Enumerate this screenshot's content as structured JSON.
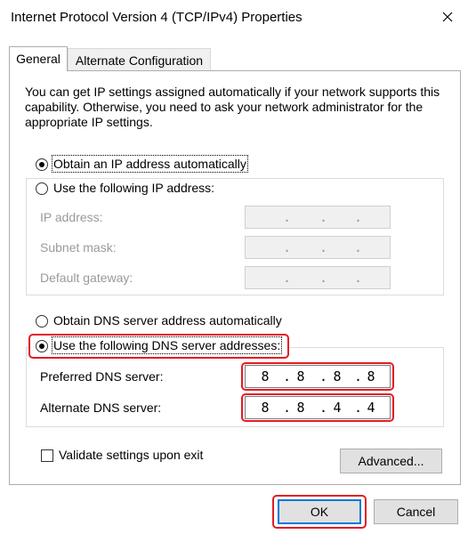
{
  "window": {
    "title": "Internet Protocol Version 4 (TCP/IPv4) Properties"
  },
  "tabs": [
    {
      "label": "General"
    },
    {
      "label": "Alternate Configuration"
    }
  ],
  "description": "You can get IP settings assigned automatically if your network supports this capability. Otherwise, you need to ask your network administrator for the appropriate IP settings.",
  "ip": {
    "auto_label": "Obtain an IP address automatically",
    "manual_label": "Use the following IP address:",
    "ip_label": "IP address:",
    "subnet_label": "Subnet mask:",
    "gateway_label": "Default gateway:"
  },
  "dns": {
    "auto_label": "Obtain DNS server address automatically",
    "manual_label": "Use the following DNS server addresses:",
    "preferred_label": "Preferred DNS server:",
    "alternate_label": "Alternate DNS server:",
    "preferred": [
      "8",
      "8",
      "8",
      "8"
    ],
    "alternate": [
      "8",
      "8",
      "4",
      "4"
    ]
  },
  "validate_label": "Validate settings upon exit",
  "buttons": {
    "advanced": "Advanced...",
    "ok": "OK",
    "cancel": "Cancel"
  },
  "colors": {
    "highlight": "#e31b23",
    "ok_border": "#0078d7"
  }
}
